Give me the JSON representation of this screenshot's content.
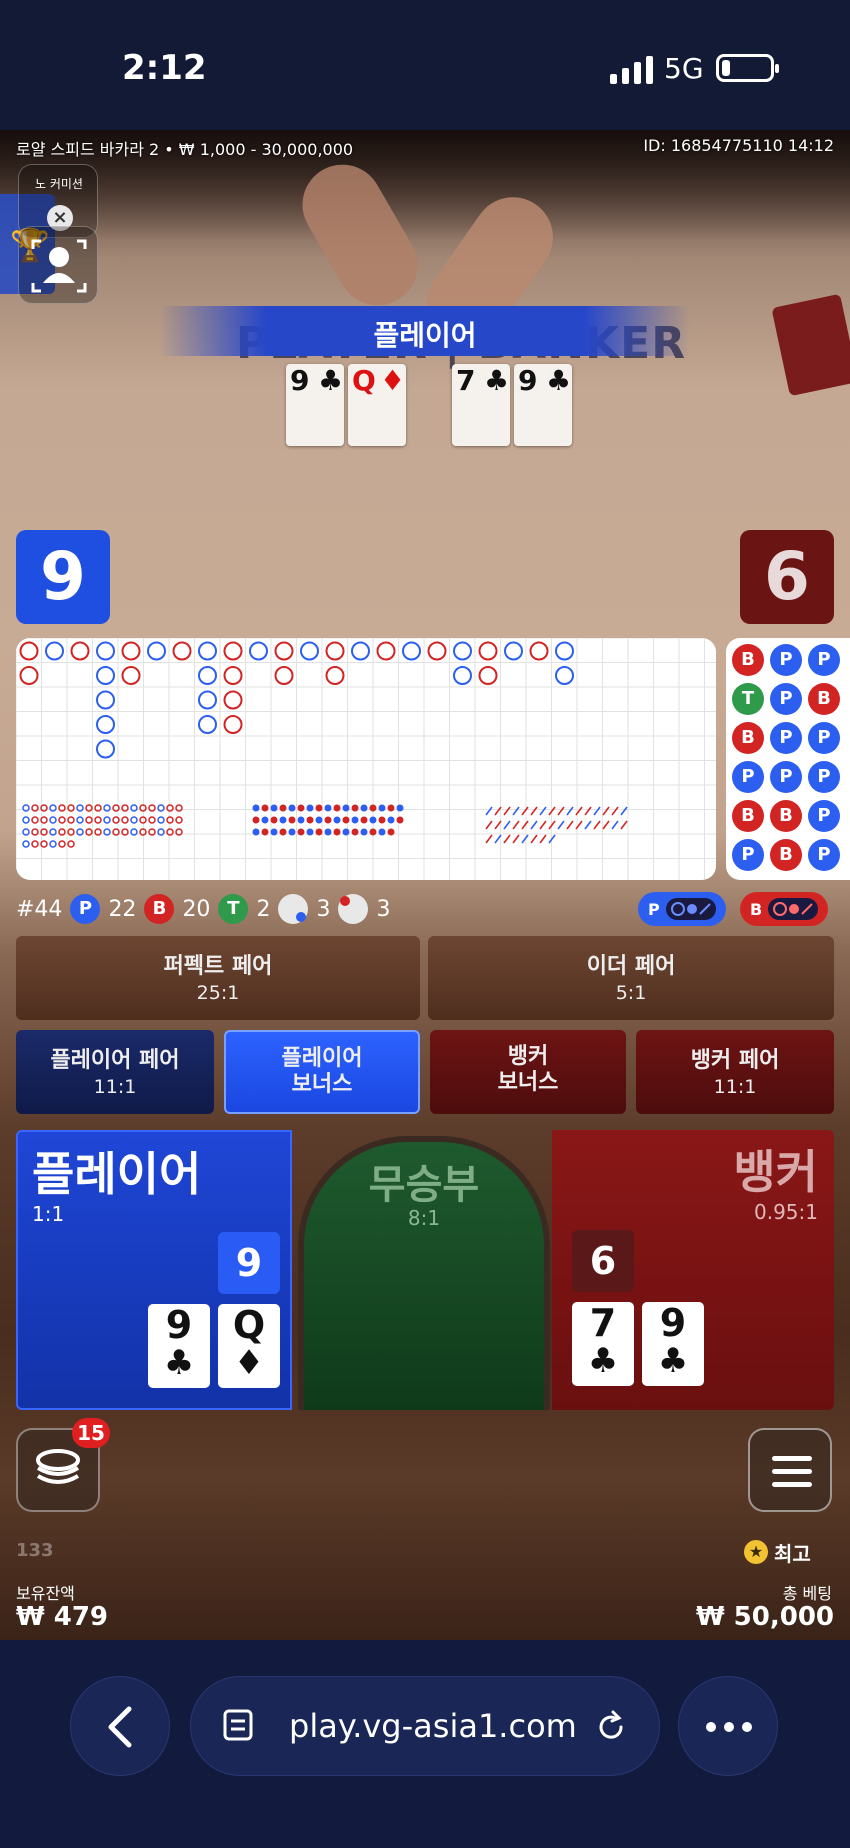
{
  "status_bar": {
    "time": "2:12",
    "network": "5G"
  },
  "game": {
    "table_info": "로얄 스피드 바카라 2 • ₩ 1,000 - 30,000,000",
    "round_id": "ID: 16854775110 14:12",
    "no_commission_label": "노 커미션",
    "banner": "플레이어",
    "felt_text": "PLAYER | BANKER",
    "player_cards": [
      {
        "rank": "9",
        "suit": "♣",
        "red": false
      },
      {
        "rank": "Q",
        "suit": "♦",
        "red": true
      }
    ],
    "banker_cards": [
      {
        "rank": "7",
        "suit": "♣",
        "red": false
      },
      {
        "rank": "9",
        "suit": "♣",
        "red": false
      }
    ],
    "player_score": "9",
    "banker_score": "6"
  },
  "stats": {
    "round": "#44",
    "player_label": "P",
    "player_count": "22",
    "banker_label": "B",
    "banker_count": "20",
    "tie_label": "T",
    "tie_count": "2",
    "player_pair_count": "3",
    "banker_pair_count": "3",
    "predict_player": "P",
    "predict_banker": "B"
  },
  "bead_road": [
    [
      "B",
      "P",
      "P"
    ],
    [
      "T",
      "P",
      "B"
    ],
    [
      "B",
      "P",
      "P"
    ],
    [
      "P",
      "P",
      "P"
    ],
    [
      "B",
      "B",
      "P"
    ],
    [
      "P",
      "B",
      "P"
    ]
  ],
  "bets": {
    "perfect_pair": {
      "label": "퍼펙트 페어",
      "odds": "25:1"
    },
    "either_pair": {
      "label": "이더 페어",
      "odds": "5:1"
    },
    "player_pair": {
      "label": "플레이어 페어",
      "odds": "11:1"
    },
    "player_bonus": {
      "label": "플레이어\n보너스"
    },
    "banker_bonus": {
      "label": "뱅커\n보너스"
    },
    "banker_pair": {
      "label": "뱅커 페어",
      "odds": "11:1"
    },
    "player": {
      "label": "플레이어",
      "odds": "1:1",
      "score": "9"
    },
    "tie": {
      "label": "무승부",
      "odds": "8:1"
    },
    "banker": {
      "label": "뱅커",
      "odds": "0.95:1",
      "score": "6"
    }
  },
  "controls": {
    "chips_badge": "15",
    "ticker_left": "133",
    "best_label": "최고",
    "balance_label": "보유잔액",
    "balance_value": "₩ 479",
    "total_bet_label": "총 베팅",
    "total_bet_value": "₩ 50,000"
  },
  "browser": {
    "url": "play.vg-asia1.com"
  },
  "colors": {
    "player_blue": "#1e4fe0",
    "banker_red": "#7a1515",
    "tie_green": "#1f5a2e"
  }
}
